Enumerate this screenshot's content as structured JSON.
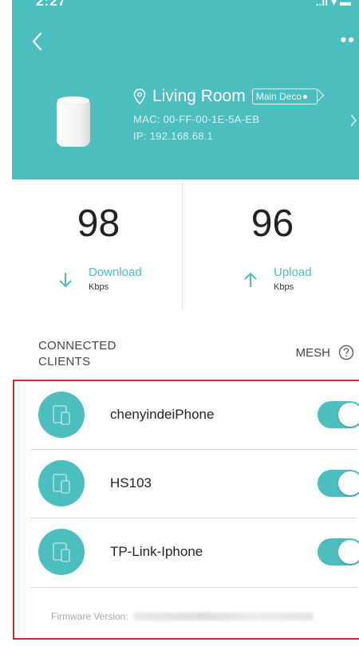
{
  "status_bar": {
    "time": "2:27",
    "right": "..ıl ▾ ▬"
  },
  "header": {
    "location": "Living Room",
    "badge": "Main Deco",
    "mac": "MAC: 00-FF-00-1E-5A-EB",
    "ip": "IP: 192.168.68.1",
    "more": "••",
    "accent": "#4cbec0"
  },
  "stats": {
    "download": {
      "value": "98",
      "label": "Download",
      "unit": "Kbps"
    },
    "upload": {
      "value": "96",
      "label": "Upload",
      "unit": "Kbps"
    }
  },
  "clients": {
    "heading_line1": "CONNECTED",
    "heading_line2": "CLIENTS",
    "mesh_label": "MESH",
    "items": [
      {
        "name": "chenyindeiPhone",
        "enabled": true,
        "icon": "devices-icon"
      },
      {
        "name": "HS103",
        "enabled": true,
        "icon": "devices-icon"
      },
      {
        "name": "TP-Link-Iphone",
        "enabled": true,
        "icon": "devices-icon"
      }
    ]
  },
  "footer": {
    "firmware_label": "Firmware Version:"
  },
  "colors": {
    "accent": "#4cbec0",
    "highlight_border": "#b5343b"
  }
}
